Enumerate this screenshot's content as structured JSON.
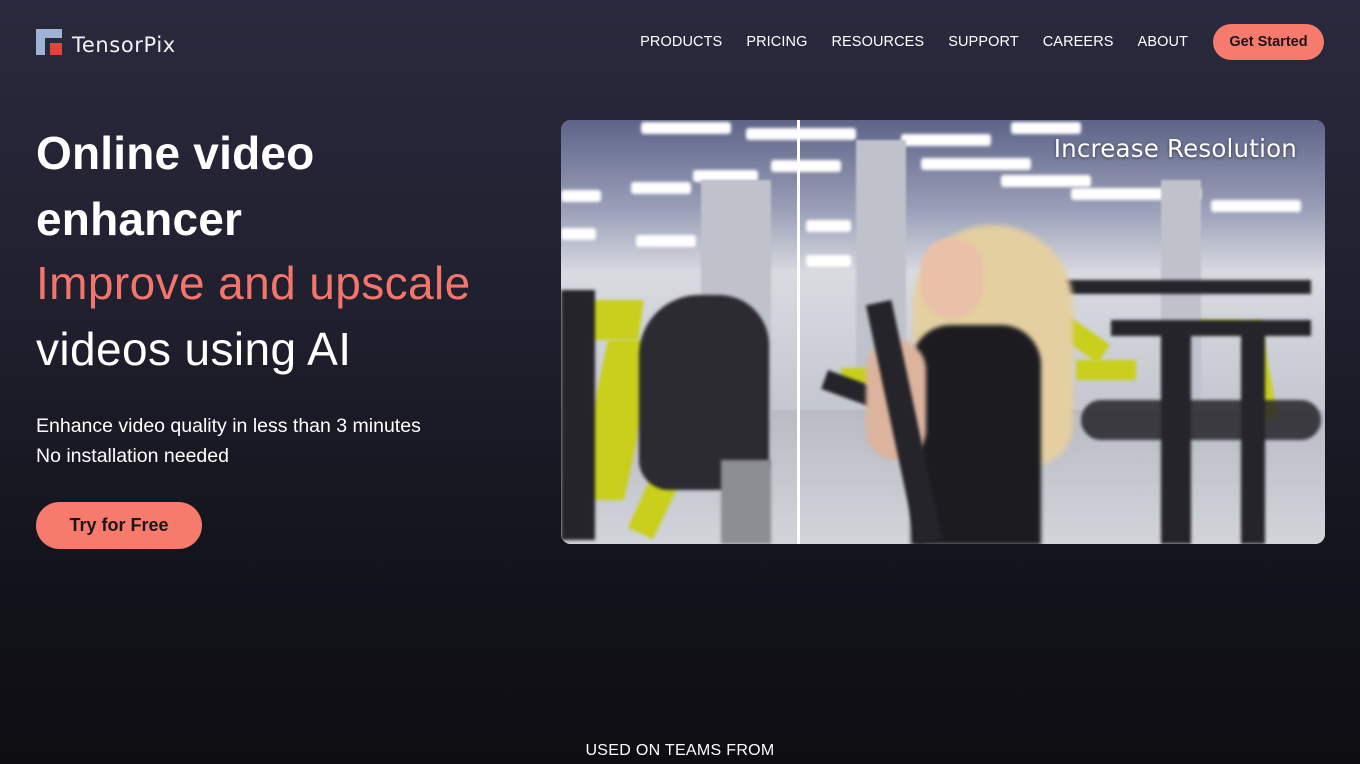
{
  "brand": {
    "name": "TensorPix",
    "logo_icon": "tensorpix-logo-icon",
    "colors": {
      "accent": "#f77b6c",
      "logo_blue": "#9fb3d6",
      "logo_red": "#e8413a",
      "background_top": "#2a2a3e",
      "background_bottom": "#0d0d12"
    }
  },
  "nav": {
    "items": [
      {
        "label": "PRODUCTS"
      },
      {
        "label": "PRICING"
      },
      {
        "label": "RESOURCES"
      },
      {
        "label": "SUPPORT"
      },
      {
        "label": "CAREERS"
      },
      {
        "label": "ABOUT"
      }
    ],
    "cta_label": "Get Started"
  },
  "hero": {
    "title_line1": "Online video",
    "title_line2": "enhancer",
    "accent_line": "Improve and upscale",
    "sub_line": "videos using AI",
    "tagline_line1": "Enhance video quality in less than 3 minutes",
    "tagline_line2": "No installation needed",
    "cta_label": "Try for Free"
  },
  "video": {
    "overlay_label": "Increase Resolution",
    "comparison": "before-after split"
  },
  "teams": {
    "heading": "USED ON TEAMS FROM"
  }
}
